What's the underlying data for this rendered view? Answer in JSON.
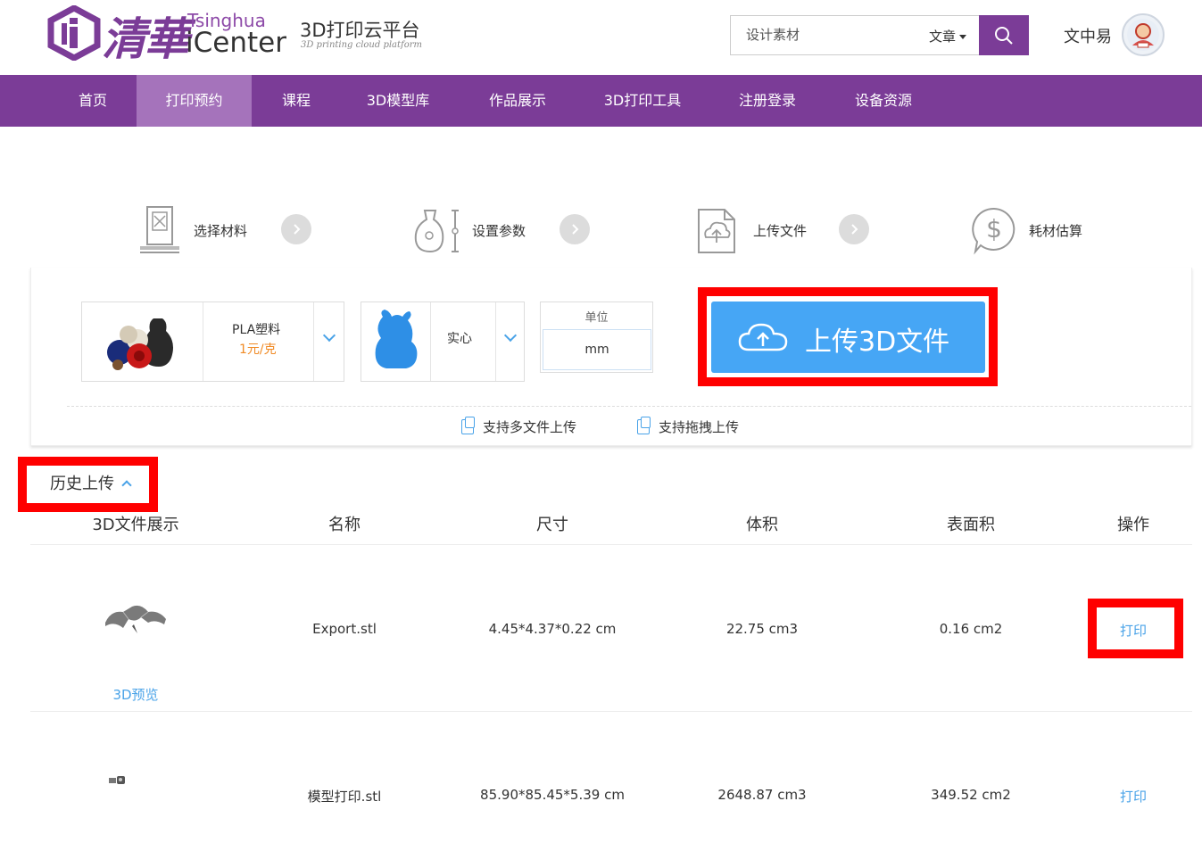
{
  "header": {
    "logo_cn": "清華",
    "logo_en_top": "Tsinghua",
    "logo_en_bottom": "iCenter",
    "platform_title": "3D打印云平台",
    "platform_subtitle": "3D printing cloud platform",
    "search_placeholder": "设计素材",
    "search_type": "文章",
    "username": "文中易"
  },
  "nav": {
    "items": [
      {
        "label": "首页"
      },
      {
        "label": "打印预约"
      },
      {
        "label": "课程"
      },
      {
        "label": "3D模型库"
      },
      {
        "label": "作品展示"
      },
      {
        "label": "3D打印工具"
      },
      {
        "label": "注册登录"
      },
      {
        "label": "设备资源"
      }
    ],
    "active_index": 1
  },
  "steps": [
    {
      "label": "选择材料",
      "icon": "printer-icon"
    },
    {
      "label": "设置参数",
      "icon": "vase-icon"
    },
    {
      "label": "上传文件",
      "icon": "file-upload-icon"
    },
    {
      "label": "耗材估算",
      "icon": "dollar-icon"
    }
  ],
  "upload": {
    "material_name": "PLA塑料",
    "material_price": "1元/克",
    "fill_type": "实心",
    "unit_label": "单位",
    "unit_value": "mm",
    "upload_button": "上传3D文件",
    "support_multi": "支持多文件上传",
    "support_drag": "支持拖拽上传"
  },
  "history": {
    "toggle_label": "历史上传",
    "columns": [
      "3D文件展示",
      "名称",
      "尺寸",
      "体积",
      "表面积",
      "操作"
    ],
    "rows": [
      {
        "name": "Export.stl",
        "size": "4.45*4.37*0.22 cm",
        "volume": "22.75 cm3",
        "area": "0.16 cm2",
        "action": "打印",
        "preview": "3D预览"
      },
      {
        "name": "模型打印.stl",
        "size": "85.90*85.45*5.39 cm",
        "volume": "2648.87 cm3",
        "area": "349.52 cm2",
        "action": "打印"
      }
    ]
  },
  "colors": {
    "brand_purple": "#7b3c97",
    "nav_active": "#a573bb",
    "upload_blue": "#46a6f5",
    "link_blue": "#4aa3e8",
    "highlight_red": "#ff0000"
  }
}
